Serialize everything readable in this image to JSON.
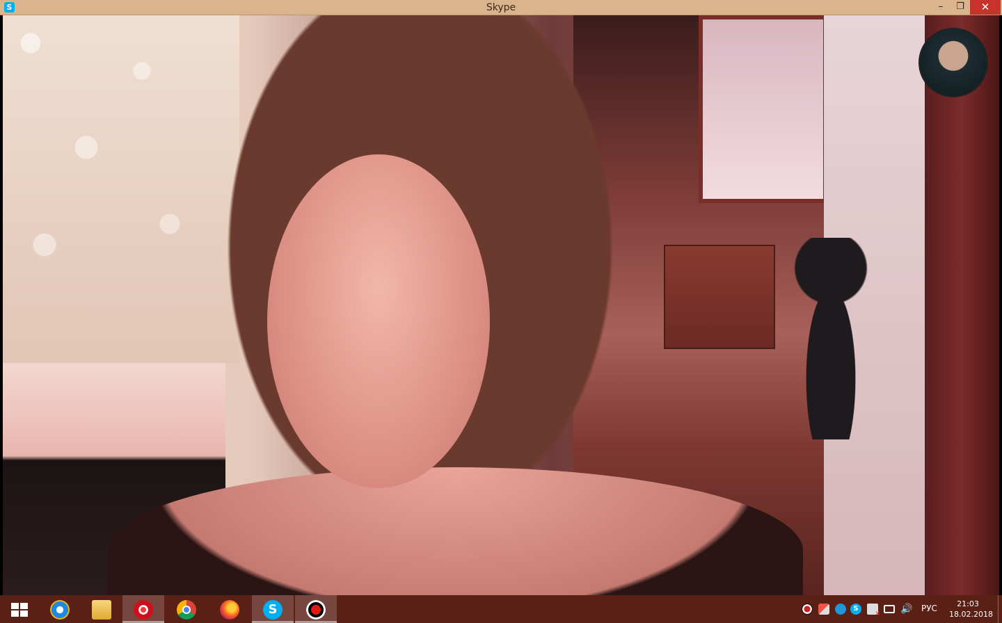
{
  "window": {
    "title": "Skype",
    "app_icon_letter": "S",
    "minimize_glyph": "–",
    "maximize_glyph": "❐",
    "close_glyph": "✕"
  },
  "call": {
    "remote_video": "remote-participant-video",
    "self_view": "self-view-avatar"
  },
  "taskbar": {
    "pinned": [
      {
        "name": "internet-explorer-icon"
      },
      {
        "name": "file-explorer-icon"
      },
      {
        "name": "opera-icon"
      },
      {
        "name": "chrome-icon"
      },
      {
        "name": "firefox-icon"
      },
      {
        "name": "skype-icon",
        "label": "S"
      },
      {
        "name": "screen-recorder-icon"
      }
    ],
    "tray": {
      "language": "РУС",
      "time": "21:03",
      "date": "18.02.2018"
    }
  },
  "colors": {
    "titlebar": "#d9b48c",
    "taskbar": "#5a1f15",
    "close_button": "#c7322b",
    "skype_blue": "#00aff0"
  }
}
